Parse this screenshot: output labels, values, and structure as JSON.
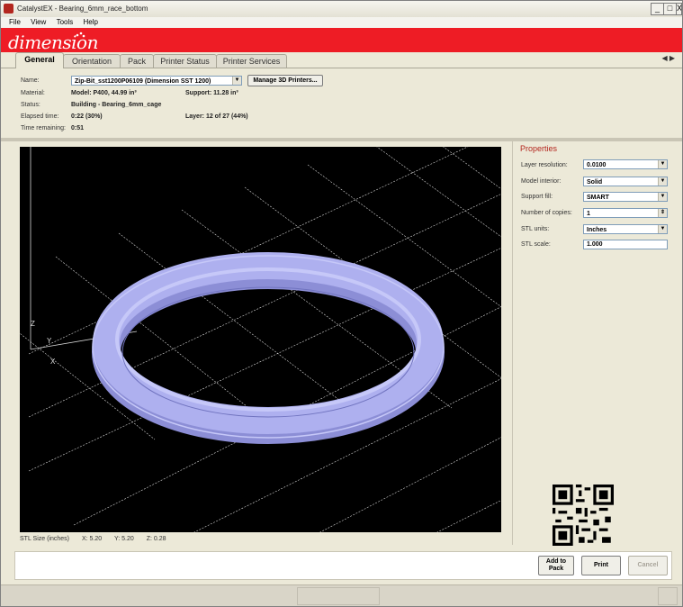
{
  "window": {
    "title": "CatalystEX - Bearing_6mm_race_bottom",
    "minimize": "_",
    "restore": "□",
    "close": "X"
  },
  "menu": [
    "File",
    "View",
    "Tools",
    "Help"
  ],
  "brand": {
    "logo_text": "dimension",
    "color": "#ee1c25"
  },
  "tabs": [
    {
      "label": "General",
      "active": true
    },
    {
      "label": "Orientation",
      "active": false
    },
    {
      "label": "Pack",
      "active": false
    },
    {
      "label": "Printer Status",
      "active": false
    },
    {
      "label": "Printer Services",
      "active": false
    }
  ],
  "tab_arrows": "◀ ▶",
  "info": {
    "name_label": "Name:",
    "name_value": "Zip-Bit_sst1200P06109  (Dimension SST 1200)",
    "manage_button": "Manage 3D Printers...",
    "material_label": "Material:",
    "model_material": "Model: P400, 44.99 in³",
    "support_material": "Support: 11.28 in³",
    "status_label": "Status:",
    "status_value": "Building  -  Bearing_6mm_cage",
    "elapsed_label": "Elapsed time:",
    "elapsed_value": "0:22  (30%)",
    "layer_value": "Layer: 12 of 27  (44%)",
    "remaining_label": "Time remaining:",
    "remaining_value": "0:51"
  },
  "viewport": {
    "axis_z": "Z",
    "axis_y": "Y",
    "axis_x": "X",
    "ring_color": "#a6a8e6",
    "grid_color": "#cfcfcf"
  },
  "stl_size": {
    "label": "STL Size (inches)",
    "x": "X:  5.20",
    "y": "Y:  5.20",
    "z": "Z:  0.28"
  },
  "properties": {
    "title": "Properties",
    "layer_resolution_label": "Layer resolution:",
    "layer_resolution_value": "0.0100",
    "model_interior_label": "Model interior:",
    "model_interior_value": "Solid",
    "support_fill_label": "Support fill:",
    "support_fill_value": "SMART",
    "copies_label": "Number of copies:",
    "copies_value": "1",
    "stl_units_label": "STL units:",
    "stl_units_value": "Inches",
    "stl_scale_label": "STL scale:",
    "stl_scale_value": "1.000"
  },
  "actions": {
    "add_to_pack": "Add to Pack",
    "print": "Print",
    "cancel": "Cancel"
  }
}
